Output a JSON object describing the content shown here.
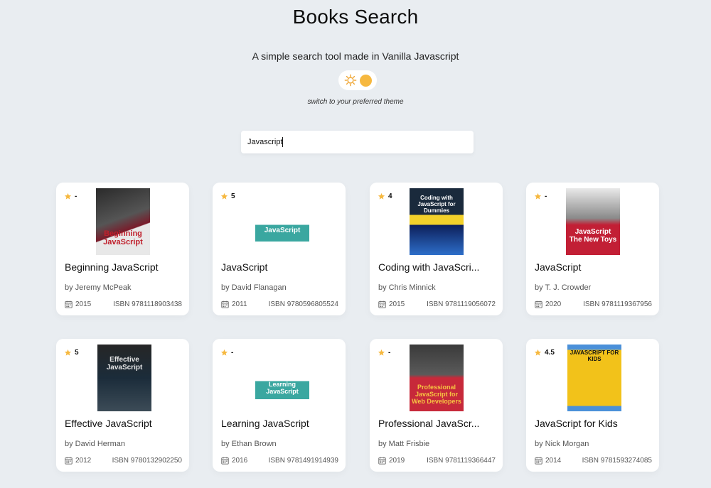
{
  "header": {
    "title": "Books Search",
    "subtitle": "A simple search tool made in Vanilla Javascript",
    "theme_caption": "switch to your preferred theme"
  },
  "search": {
    "value": "Javascript",
    "placeholder": ""
  },
  "colors": {
    "background": "#e9edf1",
    "star": "#f6b83f",
    "card": "#ffffff"
  },
  "books": [
    {
      "rating": "-",
      "title": "Beginning JavaScript",
      "author": "by Jeremy McPeak",
      "year": "2015",
      "isbn": "ISBN  9781118903438",
      "cover_text": "Beginning JavaScript"
    },
    {
      "rating": "5",
      "title": "JavaScript",
      "author": "by David Flanagan",
      "year": "2011",
      "isbn": "ISBN  9780596805524",
      "cover_text": "JavaScript"
    },
    {
      "rating": "4",
      "title": "Coding with JavaScri...",
      "author": "by Chris Minnick",
      "year": "2015",
      "isbn": "ISBN  9781119056072",
      "cover_text": "Coding with JavaScript for Dummies"
    },
    {
      "rating": "-",
      "title": "JavaScript",
      "author": "by T. J. Crowder",
      "year": "2020",
      "isbn": "ISBN  9781119367956",
      "cover_text": "JavaScript The New Toys"
    },
    {
      "rating": "5",
      "title": "Effective JavaScript",
      "author": "by David Herman",
      "year": "2012",
      "isbn": "ISBN  9780132902250",
      "cover_text": "Effective JavaScript"
    },
    {
      "rating": "-",
      "title": "Learning JavaScript",
      "author": "by Ethan Brown",
      "year": "2016",
      "isbn": "ISBN  9781491914939",
      "cover_text": "Learning JavaScript"
    },
    {
      "rating": "-",
      "title": "Professional JavaScr...",
      "author": "by Matt Frisbie",
      "year": "2019",
      "isbn": "ISBN  9781119366447",
      "cover_text": "Professional JavaScript for Web Developers"
    },
    {
      "rating": "4.5",
      "title": "JavaScript for Kids",
      "author": "by Nick Morgan",
      "year": "2014",
      "isbn": "ISBN  9781593274085",
      "cover_text": "JAVASCRIPT FOR KIDS"
    }
  ]
}
